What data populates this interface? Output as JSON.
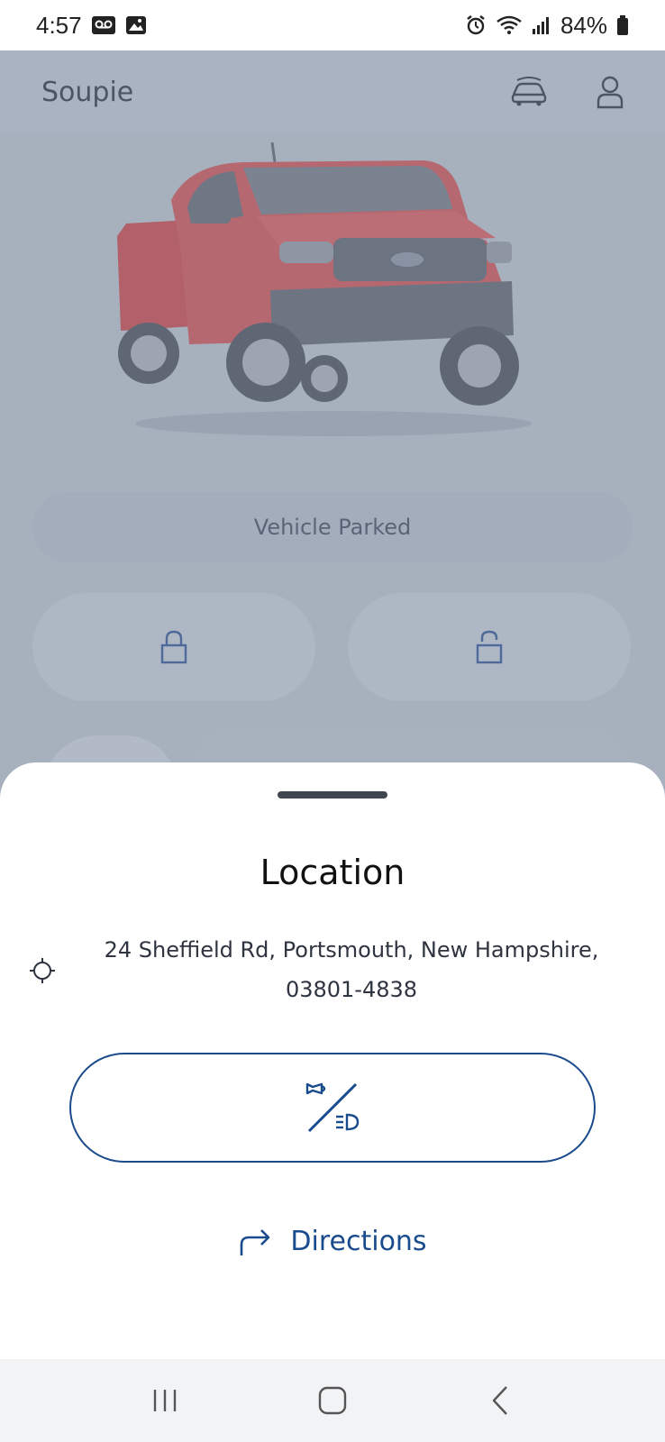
{
  "status_bar": {
    "time": "4:57",
    "battery": "84%"
  },
  "app": {
    "title": "Soupie",
    "vehicle_status": "Vehicle Parked"
  },
  "sheet": {
    "title": "Location",
    "address_line1": "24 Sheffield Rd, Portsmouth, New Hampshire,",
    "address_line2": "03801-4838",
    "directions_label": "Directions"
  },
  "colors": {
    "accent": "#1a4b8c",
    "overlay": "#a7b0bd",
    "vehicle": "#b2616a"
  }
}
